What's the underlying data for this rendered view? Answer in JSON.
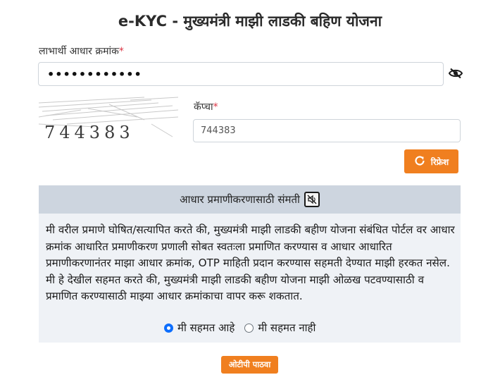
{
  "page": {
    "title": "e-KYC - मुख्यमंत्री माझी लाडकी बहिण योजना"
  },
  "aadhaar": {
    "label": "लाभार्थी आधार क्रमांक",
    "required_mark": "*",
    "value": "••••••••••••",
    "toggle_icon": "eye-slash-icon"
  },
  "captcha": {
    "image_text": "744383",
    "label": "कॅप्चा",
    "required_mark": "*",
    "value": "744383",
    "refresh_label": "रिफ्रेश",
    "refresh_icon": "refresh-icon"
  },
  "consent": {
    "header": "आधार प्रमाणीकरणासाठी संमती",
    "header_icon": "speaker-mute-icon",
    "text": "मी वरील प्रमाणे घोषित/सत्यापित करते की, मुख्यमंत्री माझी लाडकी बहीण योजना संबंधित पोर्टल वर आधार क्रमांक आधारित प्रमाणीकरण प्रणाली सोबत स्वतःला प्रमाणित करण्यास व आधार आधारित प्रमाणीकरणानंतर माझा आधार क्रमांक, OTP माहिती प्रदान करण्यास सहमती देण्यात माझी हरकत नसेल. मी हे देखील सहमत करते की, मुख्यमंत्री माझी लाडकी बहीण योजना माझी ओळख पटवण्यासाठी व प्रमाणित करण्यासाठी माझ्या आधार क्रमांकाचा वापर करू शकतात.",
    "options": [
      {
        "label": "मी सहमत आहे",
        "selected": true
      },
      {
        "label": "मी सहमत नाही",
        "selected": false
      }
    ]
  },
  "actions": {
    "send_otp_label": "ओटीपी पाठवा"
  },
  "colors": {
    "accent": "#f07f1f",
    "required": "#dc3545",
    "consent_header_bg": "#cdd5df",
    "consent_body_bg": "#eff2f6",
    "radio_checked": "#0d6efd"
  }
}
